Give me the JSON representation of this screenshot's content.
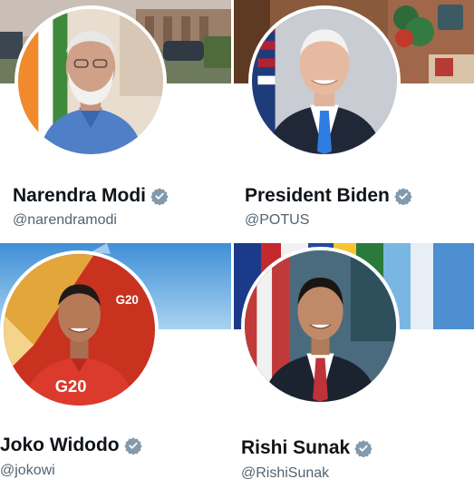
{
  "profiles": [
    {
      "name": "Narendra Modi",
      "handle": "@narendramodi",
      "verified": true
    },
    {
      "name": "President Biden",
      "handle": "@POTUS",
      "verified": true
    },
    {
      "name": "Joko Widodo",
      "handle": "@jokowi",
      "verified": true
    },
    {
      "name": "Rishi Sunak",
      "handle": "@RishiSunak",
      "verified": true
    }
  ],
  "g20_logo_text": "G20",
  "jacket_text": "G20",
  "colors": {
    "name_text": "#0f1419",
    "handle_text": "#536471",
    "verified_badge": "#829aab",
    "avatar_ring": "#ffffff"
  }
}
